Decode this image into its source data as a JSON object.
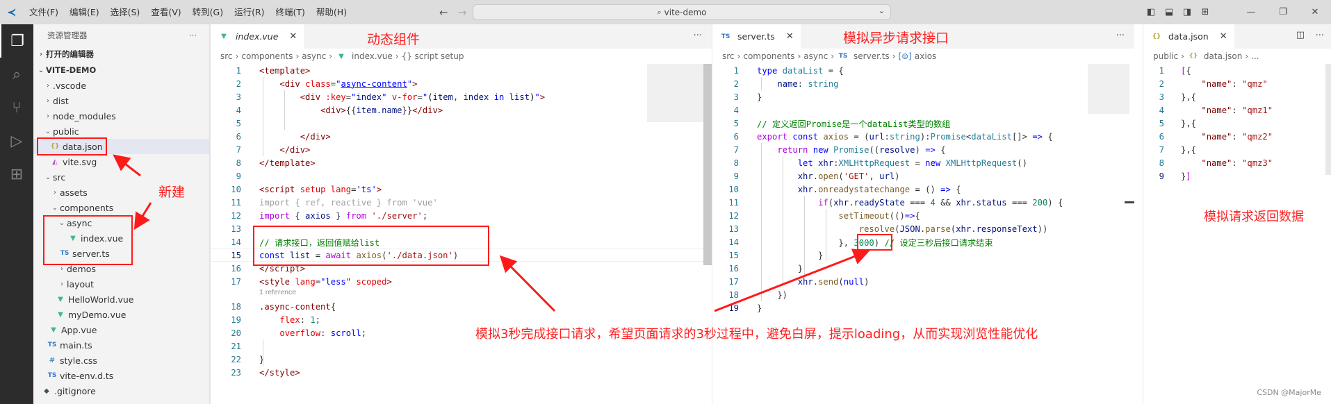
{
  "titlebar": {
    "menus": [
      "文件(F)",
      "编辑(E)",
      "选择(S)",
      "查看(V)",
      "转到(G)",
      "运行(R)",
      "终端(T)",
      "帮助(H)"
    ],
    "search": "vite-demo"
  },
  "sidebar": {
    "title": "资源管理器",
    "open_editors": "打开的编辑器",
    "project": "VITE-DEMO",
    "tree": [
      ".vscode",
      "dist",
      "node_modules",
      "public",
      "data.json",
      "vite.svg",
      "src",
      "assets",
      "components",
      "async",
      "index.vue",
      "server.ts",
      "demos",
      "layout",
      "HelloWorld.vue",
      "myDemo.vue",
      "App.vue",
      "main.ts",
      "style.css",
      "vite-env.d.ts",
      ".gitignore"
    ]
  },
  "editor1": {
    "tab": "index.vue",
    "breadcrumb": [
      "src",
      "components",
      "async",
      "index.vue",
      "{} script setup"
    ],
    "lens": "1 reference",
    "line_numbers": [
      "1",
      "2",
      "3",
      "4",
      "5",
      "6",
      "7",
      "8",
      "9",
      "10",
      "11",
      "12",
      "13",
      "14",
      "15",
      "16",
      "17",
      "18",
      "19",
      "20",
      "21",
      "22",
      "23"
    ]
  },
  "editor2": {
    "tab": "server.ts",
    "breadcrumb": [
      "src",
      "components",
      "async",
      "server.ts",
      "axios"
    ],
    "line_numbers": [
      "1",
      "2",
      "3",
      "4",
      "5",
      "6",
      "7",
      "8",
      "9",
      "10",
      "11",
      "12",
      "13",
      "14",
      "15",
      "16",
      "17",
      "18",
      "19"
    ]
  },
  "editor3": {
    "tab": "data.json",
    "breadcrumb": [
      "public",
      "data.json",
      "..."
    ],
    "line_numbers": [
      "1",
      "2",
      "3",
      "4",
      "5",
      "6",
      "7",
      "8",
      "9"
    ],
    "names": [
      "qmz",
      "qmz1",
      "qmz2",
      "qmz3"
    ]
  },
  "annotations": {
    "dynamic_component": "动态组件",
    "mock_async": "模拟异步请求接口",
    "new_created": "新建",
    "mock_return": "模拟请求返回数据",
    "description": "模拟3秒完成接口请求，希望页面请求的3秒过程中，避免白屏，提示loading，从而实现浏览性能优化",
    "timeout_value": "3000"
  },
  "watermark": "CSDN @MajorMe",
  "colors": {
    "annotation": "#ff1a1a",
    "activity_bar": "#2c2c2c",
    "vue_icon": "#41b883",
    "ts_icon": "#3178c6"
  }
}
